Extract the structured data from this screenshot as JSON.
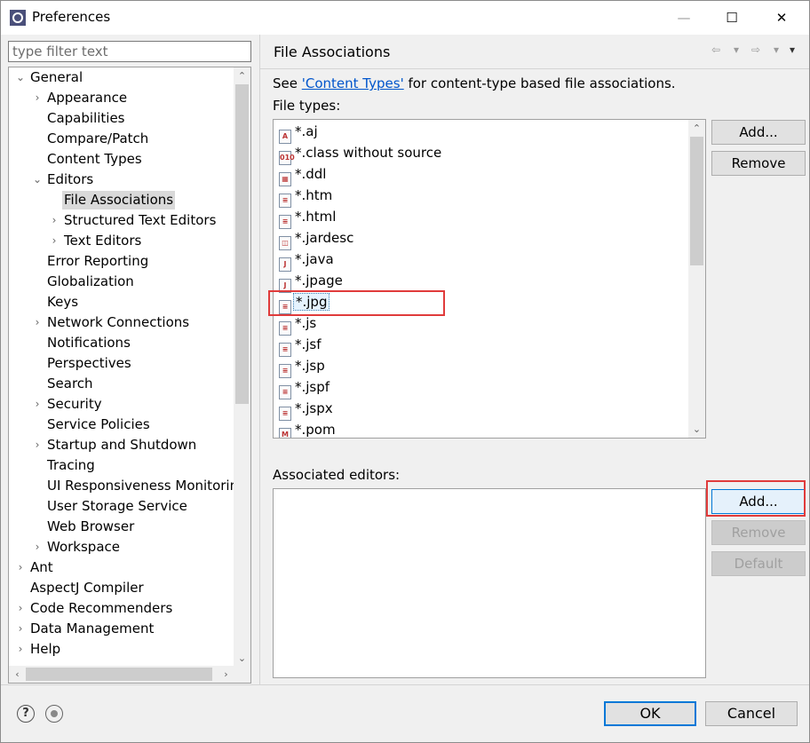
{
  "window": {
    "title": "Preferences",
    "minimize": "—",
    "maximize": "☐",
    "close": "✕"
  },
  "filter": {
    "placeholder": "type filter text"
  },
  "tree": {
    "items": [
      {
        "label": "General",
        "level": 0,
        "expanded": true
      },
      {
        "label": "Appearance",
        "level": 1,
        "expandable": true
      },
      {
        "label": "Capabilities",
        "level": 1
      },
      {
        "label": "Compare/Patch",
        "level": 1
      },
      {
        "label": "Content Types",
        "level": 1
      },
      {
        "label": "Editors",
        "level": 1,
        "expanded": true
      },
      {
        "label": "File Associations",
        "level": 2,
        "selected": true
      },
      {
        "label": "Structured Text Editors",
        "level": 2,
        "expandable": true
      },
      {
        "label": "Text Editors",
        "level": 2,
        "expandable": true
      },
      {
        "label": "Error Reporting",
        "level": 1
      },
      {
        "label": "Globalization",
        "level": 1
      },
      {
        "label": "Keys",
        "level": 1
      },
      {
        "label": "Network Connections",
        "level": 1,
        "expandable": true
      },
      {
        "label": "Notifications",
        "level": 1
      },
      {
        "label": "Perspectives",
        "level": 1
      },
      {
        "label": "Search",
        "level": 1
      },
      {
        "label": "Security",
        "level": 1,
        "expandable": true
      },
      {
        "label": "Service Policies",
        "level": 1
      },
      {
        "label": "Startup and Shutdown",
        "level": 1,
        "expandable": true
      },
      {
        "label": "Tracing",
        "level": 1
      },
      {
        "label": "UI Responsiveness Monitoring",
        "level": 1
      },
      {
        "label": "User Storage Service",
        "level": 1
      },
      {
        "label": "Web Browser",
        "level": 1
      },
      {
        "label": "Workspace",
        "level": 1,
        "expandable": true
      },
      {
        "label": "Ant",
        "level": 0,
        "expandable": true
      },
      {
        "label": "AspectJ Compiler",
        "level": 0
      },
      {
        "label": "Code Recommenders",
        "level": 0,
        "expandable": true
      },
      {
        "label": "Data Management",
        "level": 0,
        "expandable": true
      },
      {
        "label": "Help",
        "level": 0,
        "expandable": true
      }
    ]
  },
  "page": {
    "title": "File Associations",
    "see_prefix": "See ",
    "see_link": "'Content Types'",
    "see_suffix": " for content-type based file associations.",
    "file_types_label": "File types:",
    "associated_label": "Associated editors:",
    "file_types": [
      {
        "name": "*.aj",
        "icon": "aspectj-file-icon",
        "glyph": "A"
      },
      {
        "name": "*.class without source",
        "icon": "class-file-icon",
        "glyph": "010"
      },
      {
        "name": "*.ddl",
        "icon": "ddl-file-icon",
        "glyph": "▦"
      },
      {
        "name": "*.htm",
        "icon": "html-file-icon",
        "glyph": "≡"
      },
      {
        "name": "*.html",
        "icon": "html-file-icon",
        "glyph": "≡"
      },
      {
        "name": "*.jardesc",
        "icon": "jardesc-file-icon",
        "glyph": "◫"
      },
      {
        "name": "*.java",
        "icon": "java-file-icon",
        "glyph": "J"
      },
      {
        "name": "*.jpage",
        "icon": "jpage-file-icon",
        "glyph": "J"
      },
      {
        "name": "*.jpg",
        "icon": "text-file-icon",
        "glyph": "≡",
        "selected": true
      },
      {
        "name": "*.js",
        "icon": "js-file-icon",
        "glyph": "≡"
      },
      {
        "name": "*.jsf",
        "icon": "text-file-icon",
        "glyph": "≡"
      },
      {
        "name": "*.jsp",
        "icon": "text-file-icon",
        "glyph": "≡"
      },
      {
        "name": "*.jspf",
        "icon": "text-file-icon",
        "glyph": "≡"
      },
      {
        "name": "*.jspx",
        "icon": "text-file-icon",
        "glyph": "≡"
      },
      {
        "name": "*.pom",
        "icon": "maven-file-icon",
        "glyph": "M"
      }
    ]
  },
  "buttons": {
    "add": "Add...",
    "remove": "Remove",
    "default": "Default",
    "ok": "OK",
    "cancel": "Cancel"
  },
  "nav": {
    "back": "⇦",
    "forward": "⇨",
    "dropdown": "▾",
    "menu": "▾"
  },
  "icons": {
    "help_glyph": "?"
  },
  "colors": {
    "highlight": "#e03b3b",
    "link": "#0055cc",
    "focus": "#0078d7"
  }
}
